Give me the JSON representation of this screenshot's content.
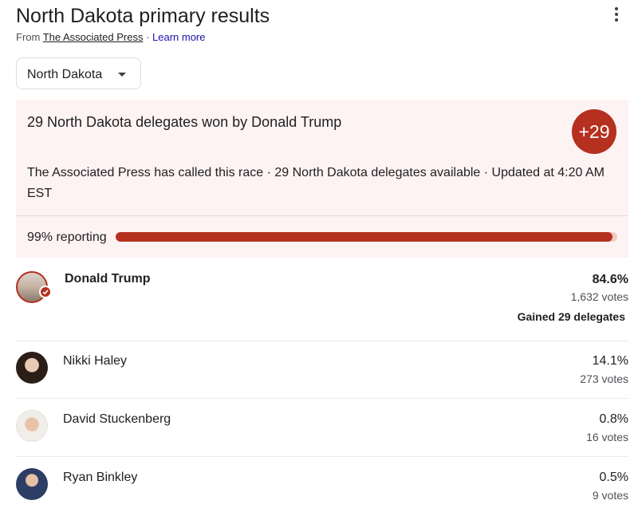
{
  "header": {
    "title": "North Dakota primary results",
    "source_prefix": "From ",
    "source_name": "The Associated Press",
    "separator": " · ",
    "learn_more": "Learn more"
  },
  "state_select": {
    "value": "North Dakota"
  },
  "summary": {
    "headline": "29 North Dakota delegates won by Donald Trump",
    "badge": "+29",
    "status": "The Associated Press has called this race · 29 North Dakota delegates available · Updated at 4:20 AM EST",
    "reporting_label": "99% reporting",
    "reporting_fraction": 0.99
  },
  "candidates": [
    {
      "name": "Donald Trump",
      "percent": "84.6%",
      "votes": "1,632 votes",
      "delegates_note": "Gained 29 delegates",
      "winner": true
    },
    {
      "name": "Nikki Haley",
      "percent": "14.1%",
      "votes": "273 votes"
    },
    {
      "name": "David Stuckenberg",
      "percent": "0.8%",
      "votes": "16 votes"
    },
    {
      "name": "Ryan Binkley",
      "percent": "0.5%",
      "votes": "9 votes"
    }
  ],
  "colors": {
    "accent": "#b5301f",
    "callout_bg": "#fdf3f2",
    "link": "#1a0dab"
  },
  "icons": [
    "more-vert-icon",
    "dropdown-caret-icon",
    "winner-check-icon"
  ]
}
